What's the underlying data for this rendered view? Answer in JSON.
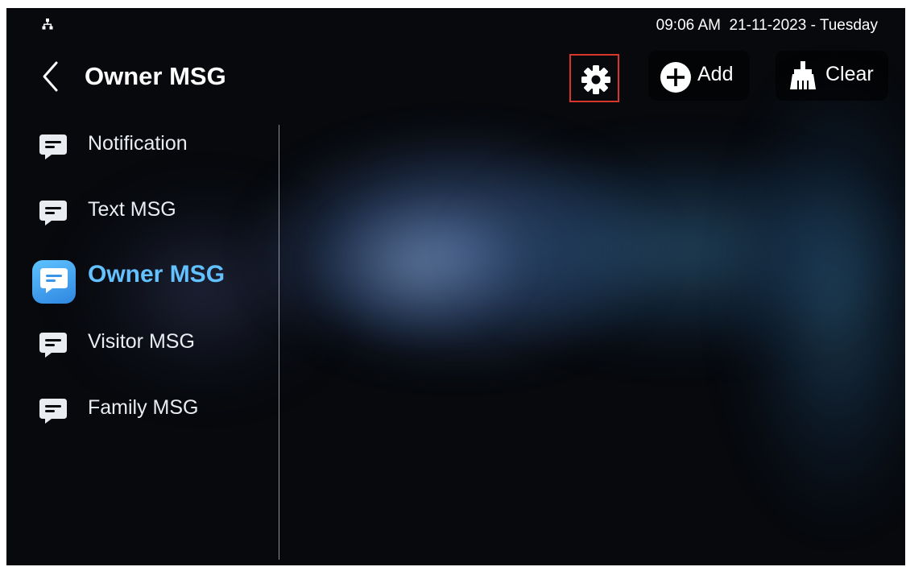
{
  "status_bar": {
    "network_icon": "network-topology-icon",
    "datetime": "09:06 AM  21-11-2023 - Tuesday"
  },
  "header": {
    "back_icon": "chevron-left-icon",
    "title": "Owner MSG"
  },
  "toolbar": {
    "settings_icon": "gear-icon",
    "add_icon": "plus-circle-icon",
    "add_label": "Add",
    "clear_icon": "broom-icon",
    "clear_label": "Clear"
  },
  "sidebar": {
    "selected_index": 2,
    "items": [
      {
        "label": "Notification",
        "icon": "message-icon"
      },
      {
        "label": "Text MSG",
        "icon": "message-icon"
      },
      {
        "label": "Owner MSG",
        "icon": "message-icon"
      },
      {
        "label": "Visitor MSG",
        "icon": "message-icon"
      },
      {
        "label": "Family MSG",
        "icon": "message-icon"
      }
    ]
  },
  "colors": {
    "active_text": "#63c1ff",
    "active_icon_bg": "#3fa3f0",
    "highlight_border": "#d8362a",
    "background": "#07090d"
  }
}
